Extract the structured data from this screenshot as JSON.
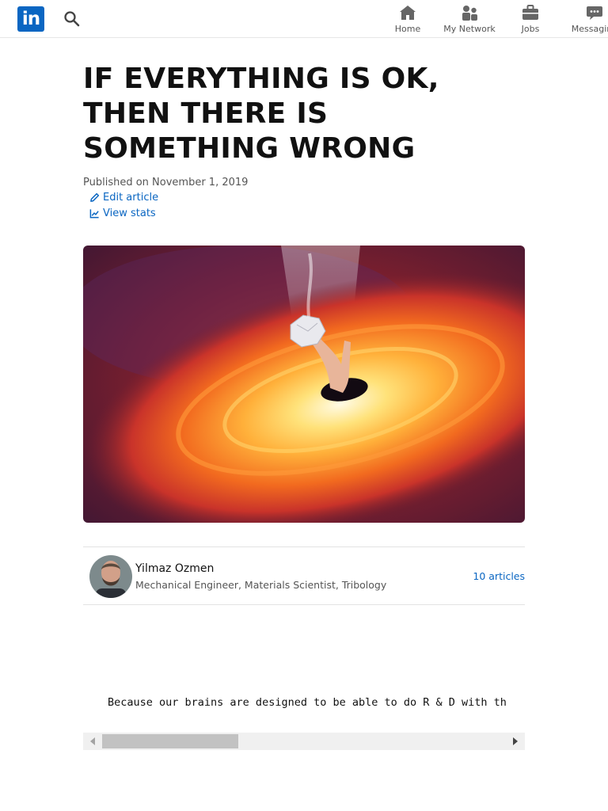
{
  "nav": {
    "logo_text": "in",
    "items": [
      {
        "label": "Home",
        "icon": "home-icon"
      },
      {
        "label": "My Network",
        "icon": "people-icon"
      },
      {
        "label": "Jobs",
        "icon": "briefcase-icon"
      },
      {
        "label": "Messaging",
        "icon": "chat-icon"
      }
    ]
  },
  "article": {
    "title": "IF EVERYTHING IS OK, THEN THERE IS SOMETHING WRONG",
    "published": "Published on November 1, 2019",
    "edit_label": "Edit article",
    "stats_label": "View stats"
  },
  "author": {
    "name": "Yilmaz Ozmen",
    "headline": "Mechanical Engineer, Materials Scientist, Tribology",
    "articles_count": "10 articles"
  },
  "body": {
    "preformatted_text": "Because our brains are designed to be able to do R & D with th"
  },
  "colors": {
    "brand": "#0a66c2",
    "text": "#111111",
    "muted": "#555555"
  }
}
